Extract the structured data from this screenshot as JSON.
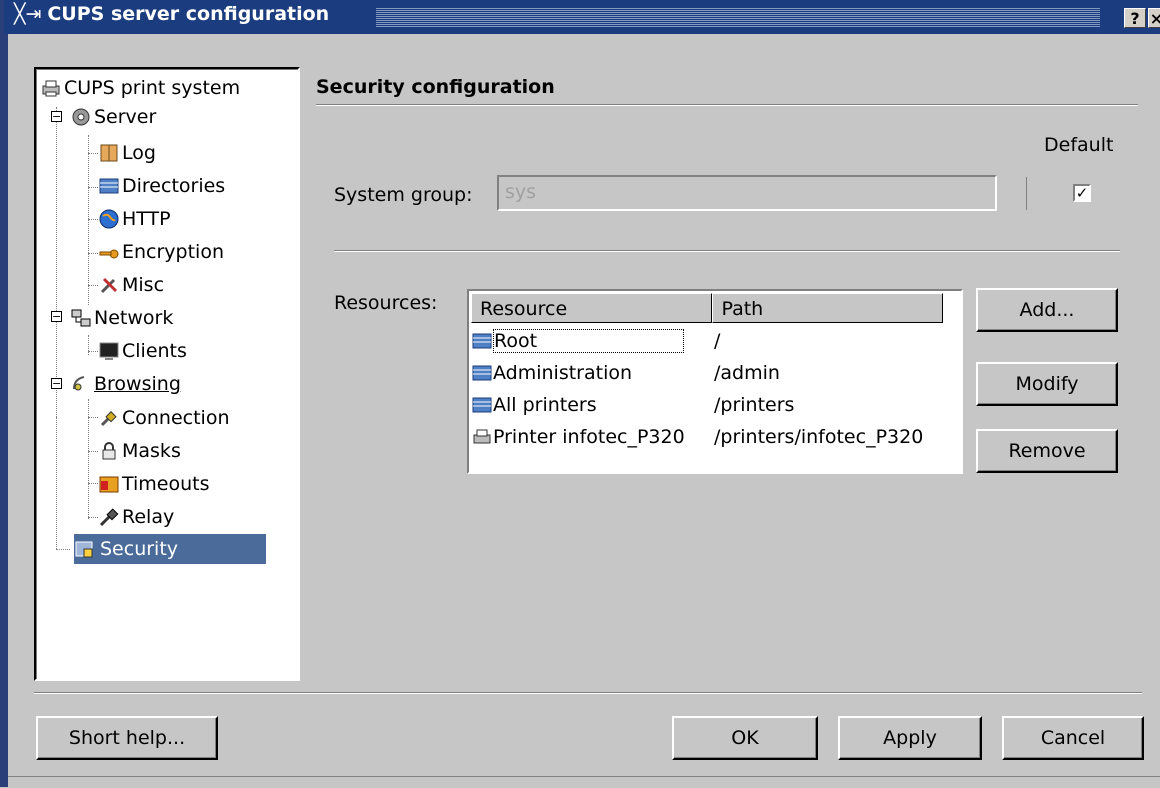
{
  "window": {
    "title": "CUPS server configuration",
    "help_btn": "?",
    "close_btn": "×"
  },
  "tree": {
    "root": "CUPS print system",
    "items": [
      {
        "label": "Server"
      },
      {
        "label": "Log"
      },
      {
        "label": "Directories"
      },
      {
        "label": "HTTP"
      },
      {
        "label": "Encryption"
      },
      {
        "label": "Misc"
      },
      {
        "label": "Network"
      },
      {
        "label": "Clients"
      },
      {
        "label": "Browsing"
      },
      {
        "label": "Connection"
      },
      {
        "label": "Masks"
      },
      {
        "label": "Timeouts"
      },
      {
        "label": "Relay"
      },
      {
        "label": "Security"
      }
    ],
    "selected": "Security"
  },
  "panel": {
    "title": "Security configuration",
    "default_label": "Default",
    "system_group_label": "System group:",
    "system_group_value": "sys",
    "default_checked": true,
    "resources_label": "Resources:",
    "columns": [
      "Resource",
      "Path"
    ],
    "rows": [
      {
        "resource": "Root",
        "path": "/"
      },
      {
        "resource": "Administration",
        "path": "/admin"
      },
      {
        "resource": "All printers",
        "path": "/printers"
      },
      {
        "resource": "Printer infotec_P320",
        "path": "/printers/infotec_P320"
      }
    ],
    "add_label": "Add...",
    "modify_label": "Modify",
    "remove_label": "Remove"
  },
  "footer": {
    "short_help_label": "Short help...",
    "ok_label": "OK",
    "apply_label": "Apply",
    "cancel_label": "Cancel"
  },
  "colors": {
    "titlebar": "#1b3c7e",
    "selection": "#4b6c9a",
    "dialog_bg": "#c6c6c6"
  }
}
